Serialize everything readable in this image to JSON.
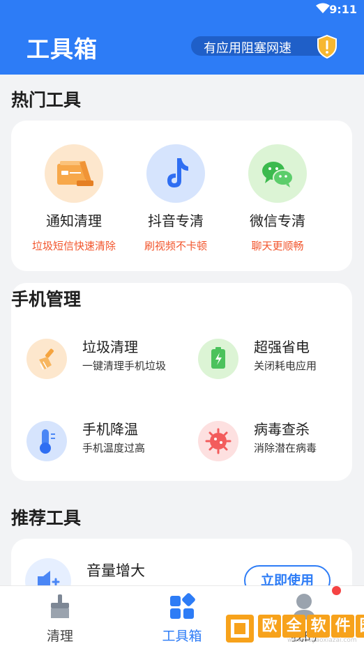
{
  "status_bar": {
    "time": "9:11"
  },
  "header": {
    "title": "工具箱",
    "alert": "有应用阻塞网速"
  },
  "hot_tools": {
    "title": "热门工具",
    "items": [
      {
        "name": "通知清理",
        "desc": "垃圾短信快速清除",
        "icon": "notification-clean-icon"
      },
      {
        "name": "抖音专清",
        "desc": "刷视频不卡顿",
        "icon": "tiktok-icon"
      },
      {
        "name": "微信专清",
        "desc": "聊天更顺畅",
        "icon": "wechat-icon"
      }
    ]
  },
  "phone_manage": {
    "title": "手机管理",
    "items": [
      {
        "name": "垃圾清理",
        "desc": "一键清理手机垃圾",
        "icon": "broom-icon"
      },
      {
        "name": "超强省电",
        "desc": "关闭耗电应用",
        "icon": "battery-icon"
      },
      {
        "name": "手机降温",
        "desc": "手机温度过高",
        "icon": "thermometer-icon"
      },
      {
        "name": "病毒查杀",
        "desc": "消除潜在病毒",
        "icon": "virus-icon"
      }
    ]
  },
  "recommend": {
    "title": "推荐工具",
    "item": {
      "name": "音量增大",
      "button": "立即使用",
      "icon": "volume-icon"
    }
  },
  "bottom_nav": {
    "items": [
      {
        "label": "清理",
        "active": false
      },
      {
        "label": "工具箱",
        "active": true
      },
      {
        "label": "我的",
        "active": false
      }
    ]
  },
  "watermark": {
    "chars": [
      "欧",
      "全",
      "软",
      "件",
      "园"
    ],
    "url": "www.ouyaoxiazai.com"
  },
  "colors": {
    "primary": "#2d7cf6",
    "accent_red": "#f2552c",
    "background": "#f2f3f5"
  }
}
